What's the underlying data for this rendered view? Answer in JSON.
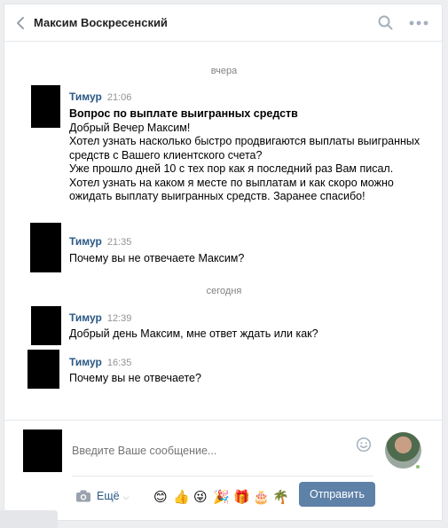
{
  "header": {
    "title": "Максим Воскресенский"
  },
  "dates": {
    "yesterday": "вчера",
    "today": "сегодня"
  },
  "messages": [
    {
      "author": "Тимур",
      "time": "21:06",
      "subject": "Вопрос по выплате выигранных средств",
      "text": "Добрый Вечер Максим!\nХотел узнать насколько быстро продвигаются выплаты выигранных средств с Вашего клиентского счета?\nУже прошло дней 10 с тех пор как я последний раз Вам писал. Хотел узнать на каком я месте по выплатам и как скоро можно ожидать выплату выигранных средств. Заранее спасибо!"
    },
    {
      "author": "Тимур",
      "time": "21:35",
      "text": "Почему вы не отвечаете Максим?"
    },
    {
      "author": "Тимур",
      "time": "12:39",
      "text": "Добрый день Максим, мне ответ ждать или как?"
    },
    {
      "author": "Тимур",
      "time": "16:35",
      "text": "Почему вы не отвечаете?"
    }
  ],
  "composer": {
    "placeholder": "Введите Ваше сообщение...",
    "more_label": "Ещё",
    "send_label": "Отправить",
    "emojis": [
      "😊",
      "👍",
      "😜",
      "🎉",
      "🎁",
      "🎂",
      "🌴"
    ]
  },
  "colors": {
    "link": "#2a5885",
    "send_button": "#5e81a8",
    "online": "#8ac176"
  }
}
